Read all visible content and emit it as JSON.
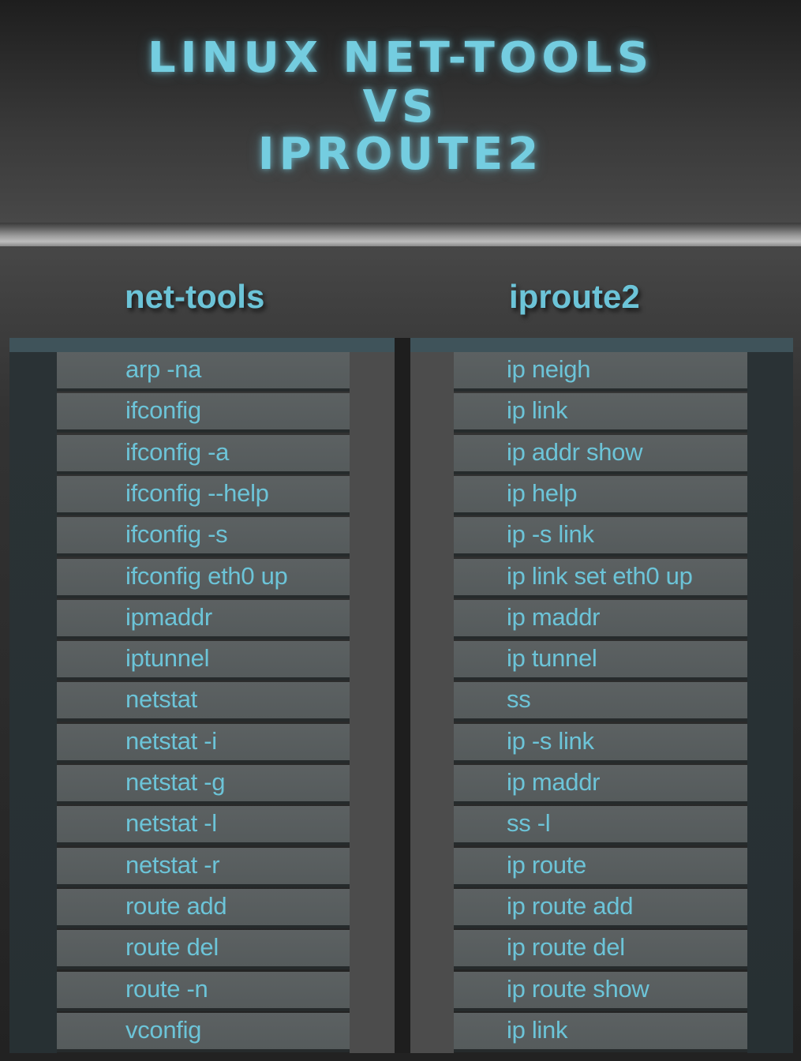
{
  "title": {
    "line1": "LINUX NET-TOOLS",
    "line2": "VS",
    "line3": "IPROUTE2"
  },
  "columns": {
    "left_header": "net-tools",
    "right_header": "iproute2"
  },
  "colors": {
    "accent": "#6cc4d8",
    "row_bg": "#585e5f",
    "background": "#2e2e2e"
  },
  "rows": [
    {
      "net_tools": "arp -na",
      "iproute2": "ip neigh"
    },
    {
      "net_tools": "ifconfig",
      "iproute2": "ip link"
    },
    {
      "net_tools": "ifconfig -a",
      "iproute2": "ip addr show"
    },
    {
      "net_tools": "ifconfig --help",
      "iproute2": "ip help"
    },
    {
      "net_tools": "ifconfig -s",
      "iproute2": "ip -s link"
    },
    {
      "net_tools": "ifconfig eth0 up",
      "iproute2": "ip link set eth0 up"
    },
    {
      "net_tools": "ipmaddr",
      "iproute2": "ip maddr"
    },
    {
      "net_tools": "iptunnel",
      "iproute2": "ip tunnel"
    },
    {
      "net_tools": "netstat",
      "iproute2": "ss"
    },
    {
      "net_tools": "netstat -i",
      "iproute2": "ip -s link"
    },
    {
      "net_tools": "netstat  -g",
      "iproute2": "ip maddr"
    },
    {
      "net_tools": "netstat -l",
      "iproute2": "ss -l"
    },
    {
      "net_tools": "netstat -r",
      "iproute2": "ip route"
    },
    {
      "net_tools": "route add",
      "iproute2": "ip route add"
    },
    {
      "net_tools": "route del",
      "iproute2": "ip route del"
    },
    {
      "net_tools": "route -n",
      "iproute2": "ip route show"
    },
    {
      "net_tools": "vconfig",
      "iproute2": "ip link"
    }
  ]
}
